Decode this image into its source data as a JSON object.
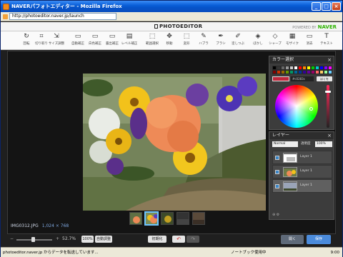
{
  "window": {
    "title": "NAVERパフォトエディター - Mozilla Firefox",
    "buttons": [
      "_",
      "□",
      "×"
    ]
  },
  "address": {
    "url": "http://photoeditor.naver.jp/launch"
  },
  "header": {
    "logo": "PHOTOEDITOR",
    "powered_by": "POWERED BY",
    "brand": "NAVER"
  },
  "toolbar": [
    {
      "icon": "rotate-icon",
      "glyph": "↻",
      "label": "回転"
    },
    {
      "icon": "crop-icon",
      "glyph": "⌗",
      "label": "切り取り"
    },
    {
      "icon": "resize-icon",
      "glyph": "⇲",
      "label": "サイズ調整"
    },
    {
      "icon": "auto-fix-icon",
      "glyph": "▭",
      "label": "自動補正"
    },
    {
      "icon": "white-balance-icon",
      "glyph": "▭",
      "label": "白色補正"
    },
    {
      "icon": "exposure-icon",
      "glyph": "▭",
      "label": "露出補正"
    },
    {
      "icon": "levels-icon",
      "glyph": "▤",
      "label": "レベル補正"
    },
    {
      "icon": "select-icon",
      "glyph": "⬚",
      "label": "範囲選択"
    },
    {
      "icon": "move-icon",
      "glyph": "✥",
      "label": "移動"
    },
    {
      "icon": "transform-icon",
      "glyph": "⬚",
      "label": "変形"
    },
    {
      "icon": "brush-icon",
      "glyph": "✎",
      "label": "ハブラ"
    },
    {
      "icon": "pen-icon",
      "glyph": "✒",
      "label": "ブラシ"
    },
    {
      "icon": "fill-icon",
      "glyph": "✐",
      "label": "塗しつぶ"
    },
    {
      "icon": "blur-icon",
      "glyph": "◈",
      "label": "ぼかし"
    },
    {
      "icon": "sharpen-icon",
      "glyph": "◇",
      "label": "シャープ"
    },
    {
      "icon": "mosaic-icon",
      "glyph": "▦",
      "label": "モザイク"
    },
    {
      "icon": "eraser-icon",
      "glyph": "▭",
      "label": "消去"
    },
    {
      "icon": "text-icon",
      "glyph": "T",
      "label": "テキスト"
    }
  ],
  "file": {
    "name": "IMG0312.JPG",
    "dims": "1,024 × 768"
  },
  "color_panel": {
    "title": "カラー選択",
    "hex": "#c0283c",
    "apply": "ほくを",
    "swatches": [
      "#000000",
      "#333333",
      "#666666",
      "#999999",
      "#cccccc",
      "#ffffff",
      "#ff0000",
      "#ff8800",
      "#ffff00",
      "#00cc00",
      "#00cccc",
      "#0000ff",
      "#8800ff",
      "#ff00ff",
      "#800000",
      "#cc3300",
      "#996600",
      "#669900",
      "#009966",
      "#006699",
      "#003399",
      "#330099",
      "#660099",
      "#990066",
      "#ff6666",
      "#ffcc66",
      "#99ff99",
      "#66ccff"
    ]
  },
  "layer_panel": {
    "title": "レイヤー",
    "blend": "Normal",
    "opacity_label": "透明度",
    "opacity": "100%",
    "layers": [
      {
        "name": "Layer 1",
        "kind": "blank"
      },
      {
        "name": "Layer 1",
        "kind": "flowers"
      },
      {
        "name": "Layer 1",
        "kind": "landscape"
      }
    ]
  },
  "bottom": {
    "zoom_minus": "−",
    "zoom_plus": "+",
    "zoom_pct": "52.7%",
    "zoom_fraction": 0.45,
    "btn_100": "100%",
    "btn_fit": "自動調整",
    "btn_reset": "初期化",
    "btn_undo": "↶",
    "btn_redo": "↷",
    "btn_open": "開く",
    "btn_save": "保存"
  },
  "status": {
    "text": "photoeditor.naver.jp からデータを転送しています...",
    "notebook": "ノートブック使用中",
    "time": "9:00"
  }
}
